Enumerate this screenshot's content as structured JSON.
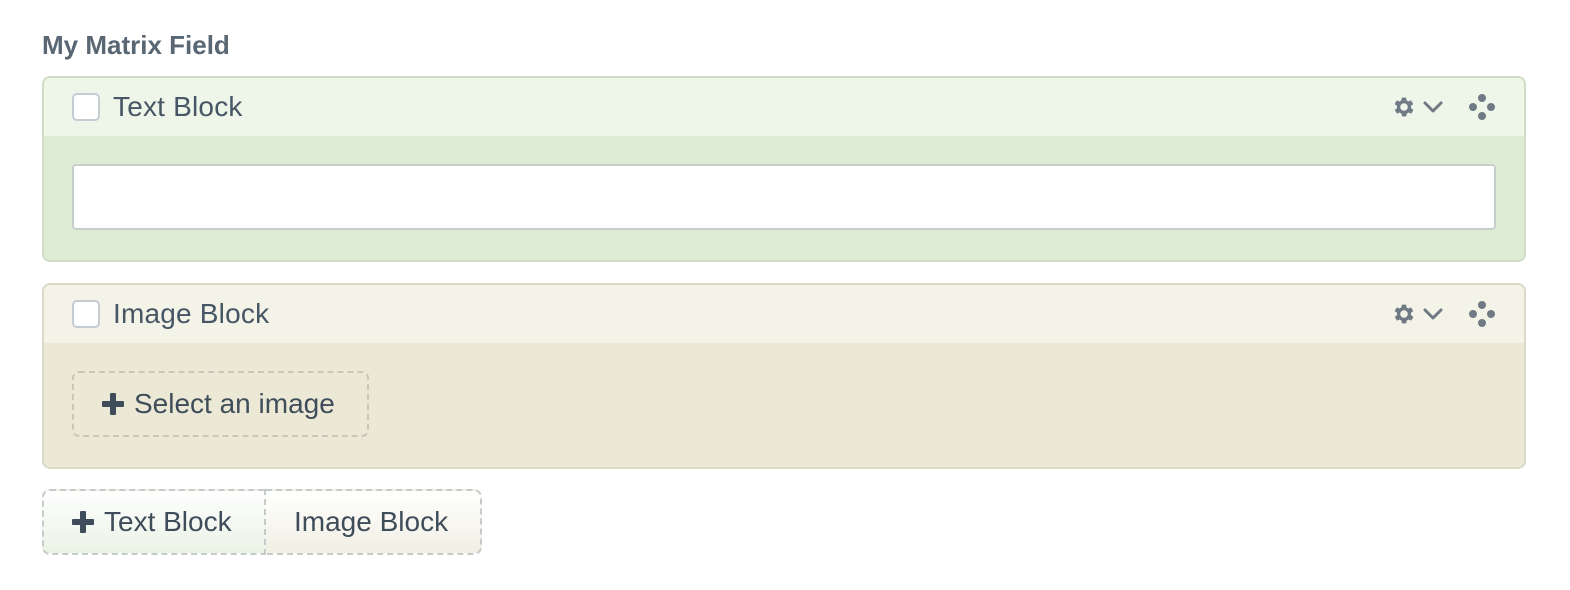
{
  "field": {
    "label": "My Matrix Field"
  },
  "blocks": [
    {
      "type": "text",
      "title": "Text Block",
      "input_value": "",
      "actions": [
        "gear-icon",
        "chevron-down-icon",
        "move-icon"
      ]
    },
    {
      "type": "image",
      "title": "Image Block",
      "select_label": "Select an image",
      "actions": [
        "gear-icon",
        "chevron-down-icon",
        "move-icon"
      ]
    }
  ],
  "add_buttons": {
    "text_label": "Text Block",
    "image_label": "Image Block"
  },
  "colors": {
    "text_block_bg": "#deebd5",
    "text_block_header": "#eef5e9",
    "image_block_bg": "#ebe9d6",
    "image_block_header": "#f4f3e8",
    "icon": "#707a84"
  }
}
